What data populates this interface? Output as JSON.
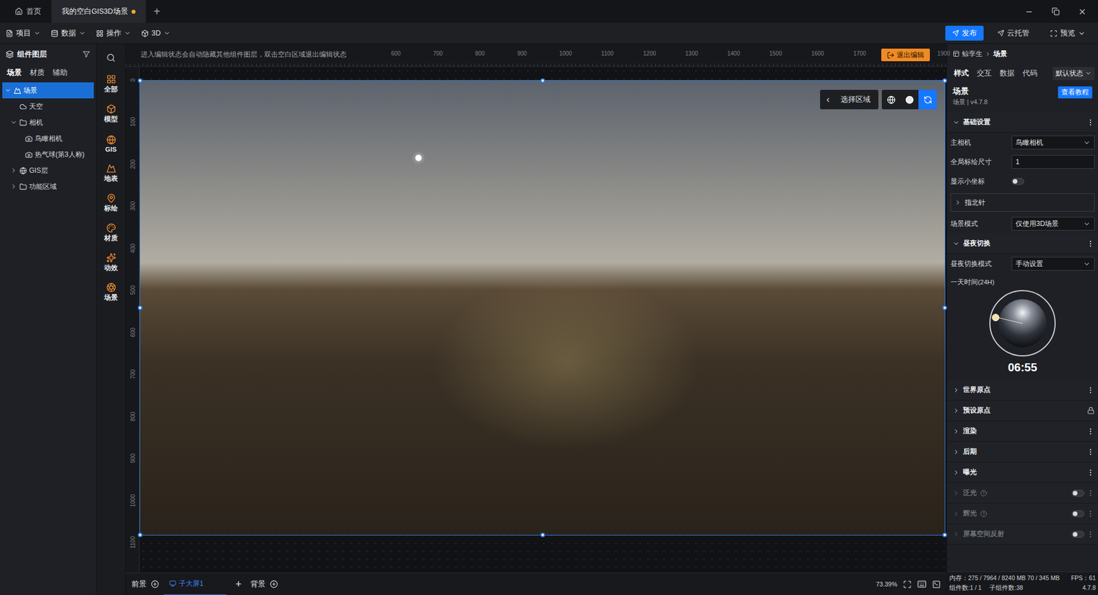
{
  "window_tabs": [
    {
      "label": "首页",
      "selected": false,
      "modified": false
    },
    {
      "label": "我的空白GIS3D场景",
      "selected": true,
      "modified": true
    }
  ],
  "new_tab": "+",
  "menu": [
    "项目",
    "数据",
    "操作",
    "3D"
  ],
  "actions": [
    {
      "label": "发布",
      "primary": true
    },
    {
      "label": "云托管",
      "primary": false
    },
    {
      "label": "预览",
      "primary": false
    }
  ],
  "layers": {
    "title": "组件图层",
    "tabs": [
      {
        "label": "场景",
        "selected": true
      },
      {
        "label": "材质",
        "selected": false
      },
      {
        "label": "辅助",
        "selected": false
      }
    ],
    "tree": [
      {
        "label": "场景",
        "kind": "scene",
        "depth": 0,
        "has_children": true,
        "expanded": true,
        "selected": true
      },
      {
        "label": "天空",
        "kind": "sky",
        "depth": 1,
        "has_children": false,
        "expanded": false,
        "selected": false
      },
      {
        "label": "相机",
        "kind": "folder",
        "depth": 1,
        "has_children": true,
        "expanded": true,
        "selected": false
      },
      {
        "label": "鸟瞰相机",
        "kind": "camera",
        "depth": 2,
        "has_children": false,
        "expanded": false,
        "selected": false
      },
      {
        "label": "热气球(第3人称)",
        "kind": "camera",
        "depth": 2,
        "has_children": false,
        "expanded": false,
        "selected": false
      },
      {
        "label": "GIS层",
        "kind": "gis",
        "depth": 1,
        "has_children": true,
        "expanded": false,
        "selected": false
      },
      {
        "label": "功能区域",
        "kind": "folder",
        "depth": 1,
        "has_children": true,
        "expanded": false,
        "selected": false
      }
    ]
  },
  "widgets": [
    "全部",
    "模型",
    "GIS",
    "地表",
    "标绘",
    "材质",
    "动效",
    "场景"
  ],
  "canvas": {
    "hint": "进入编辑状态会自动隐藏其他组件图层，双击空白区域退出编辑状态",
    "exit_button": "退出编辑",
    "ruler_x": [
      "600",
      "700",
      "800",
      "900",
      "1000",
      "1100",
      "1200",
      "1300",
      "1400",
      "1500",
      "1600",
      "1700",
      "1900"
    ],
    "ruler_y": [
      "0",
      "100",
      "200",
      "300",
      "400",
      "500",
      "600",
      "700",
      "800",
      "900",
      "1000",
      "1100"
    ],
    "toolbar": {
      "back": "‹",
      "label": "选择区域"
    },
    "view_modes": [
      {
        "selected": false
      },
      {
        "selected": false
      },
      {
        "selected": true
      }
    ]
  },
  "bottom_bar": {
    "foreground": "前景",
    "screens": [
      {
        "label": "子大屏1",
        "selected": true
      }
    ],
    "add": "+",
    "background": "背景",
    "zoom": "73.39%"
  },
  "inspector": {
    "breadcrumb": [
      "鲸孪生",
      "场景"
    ],
    "tabs": [
      {
        "label": "样式",
        "selected": true
      },
      {
        "label": "交互",
        "selected": false
      },
      {
        "label": "数据",
        "selected": false
      },
      {
        "label": "代码",
        "selected": false
      }
    ],
    "state_select": "默认状态",
    "title": "场景",
    "subtitle": "场景 | v4.7.8",
    "tutorial": "查看教程",
    "sections": [
      {
        "title": "基础设置",
        "expanded": true,
        "disabled": false,
        "trailing": "menu",
        "help": false,
        "on": false,
        "fields": [
          {
            "kind": "select",
            "label": "主相机",
            "value": "鸟瞰相机"
          },
          {
            "kind": "input",
            "label": "全局标绘尺寸",
            "value": "1"
          },
          {
            "kind": "toggle",
            "label": "显示小坐标",
            "on": false
          },
          {
            "kind": "group",
            "label": "指北针",
            "expanded": false
          },
          {
            "kind": "select",
            "label": "场景模式",
            "value": "仅使用3D场景"
          }
        ]
      },
      {
        "title": "昼夜切换",
        "expanded": true,
        "disabled": false,
        "trailing": "menu",
        "help": false,
        "on": false,
        "fields": [
          {
            "kind": "select",
            "label": "昼夜切换模式",
            "value": "手动设置"
          },
          {
            "kind": "dial",
            "label": "一天时间(24H)",
            "value": "06:55",
            "level": 0.288
          }
        ]
      },
      {
        "title": "世界原点",
        "expanded": false,
        "disabled": false,
        "trailing": "menu",
        "help": false,
        "on": false,
        "fields": []
      },
      {
        "title": "预设原点",
        "expanded": false,
        "disabled": false,
        "trailing": "lock",
        "help": false,
        "on": false,
        "fields": []
      },
      {
        "title": "渲染",
        "expanded": false,
        "disabled": false,
        "trailing": "menu",
        "help": false,
        "on": false,
        "fields": []
      },
      {
        "title": "后期",
        "expanded": false,
        "disabled": false,
        "trailing": "menu",
        "help": false,
        "on": false,
        "fields": []
      },
      {
        "title": "曝光",
        "expanded": false,
        "disabled": false,
        "trailing": "menu",
        "help": false,
        "on": false,
        "fields": []
      },
      {
        "title": "泛光",
        "expanded": false,
        "disabled": true,
        "trailing": "toggle",
        "help": true,
        "on": false,
        "fields": []
      },
      {
        "title": "辉光",
        "expanded": false,
        "disabled": true,
        "trailing": "toggle",
        "help": true,
        "on": false,
        "fields": []
      },
      {
        "title": "屏幕空间反射",
        "expanded": false,
        "disabled": true,
        "trailing": "toggle",
        "help": false,
        "on": false,
        "fields": []
      }
    ]
  },
  "status": {
    "memory": "内存：275 / 7964 / 8240 MB 70 / 345 MB",
    "fps": "FPS：61",
    "components": "组件数:1 / 1",
    "children": "子组件数:38",
    "version": "4.7.8"
  }
}
